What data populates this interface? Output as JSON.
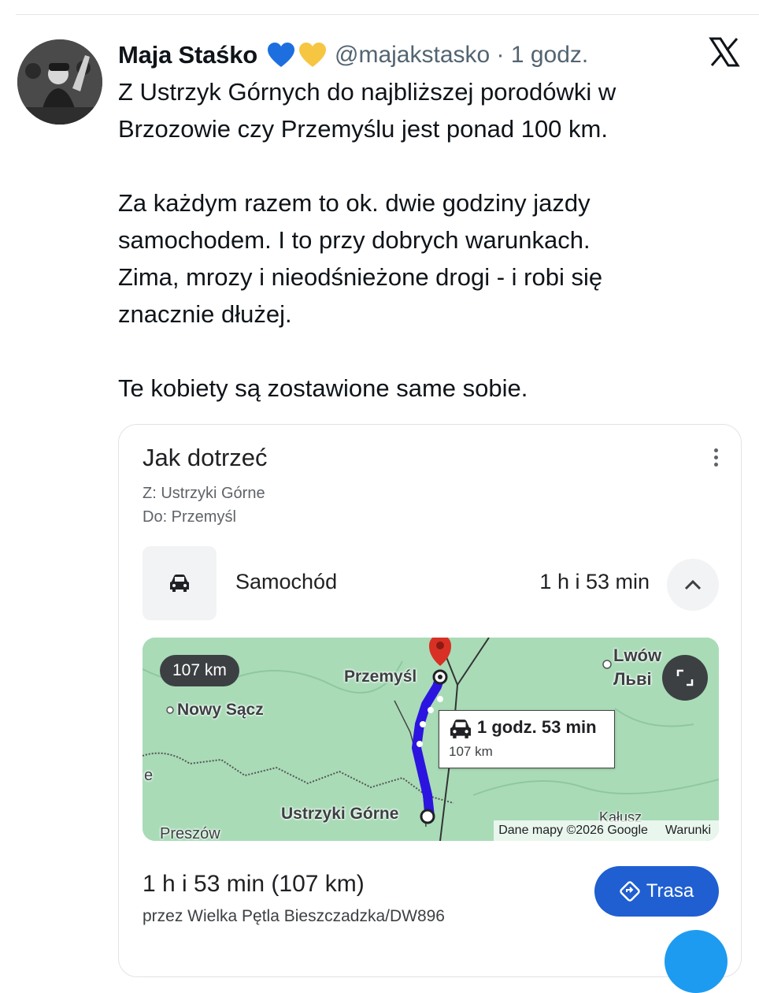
{
  "tweet": {
    "author_name": "Maja Staśko",
    "handle_time": "@majakstasko · 1 godz.",
    "emoji_icons": [
      "blue-heart-icon",
      "yellow-heart-icon"
    ],
    "text": "Z Ustrzyk Górnych do najbliższej porodówki w\nBrzozowie czy Przemyślu jest ponad 100 km.\n\nZa każdym razem to ok. dwie godziny jazdy\nsamochodem. I to przy dobrych warunkach.\nZima, mrozy i nieodśnieżone drogi - i robi się\nznacznie dłużej.\n\nTe kobiety są zostawione same sobie."
  },
  "colors": {
    "blue_heart": "#1d6fe0",
    "yellow_heart": "#f6c642",
    "route": "#2b14e0",
    "trasa_button": "#1f5fd1",
    "map_land": "#a9dbb7",
    "pin": "#d93025"
  },
  "maps_card": {
    "title": "Jak dotrzeć",
    "from": "Z: Ustrzyki Górne",
    "to": "Do: Przemyśl",
    "mode_icon": "car-icon",
    "mode_label": "Samochód",
    "mode_duration": "1 h i 53 min",
    "summary": "1 h i 53 min (107 km)",
    "via": "przez Wielka Pętla Bieszczadzka/DW896",
    "route_button": "Trasa"
  },
  "map": {
    "distance_pill": "107 km",
    "callout_time": "1 godz. 53 min",
    "callout_distance": "107 km",
    "place_przemysl": "Przemyśl",
    "place_nowy_sacz": "Nowy Sącz",
    "place_ustrzyki": "Ustrzyki Górne",
    "place_lwow": "Lwów",
    "place_lvi": "Львi",
    "place_rzeszow": "Preszów",
    "place_kalusz": "Kałusz",
    "place_e": "e",
    "attribution": "Dane mapy ©2026 Google",
    "terms": "Warunki"
  }
}
